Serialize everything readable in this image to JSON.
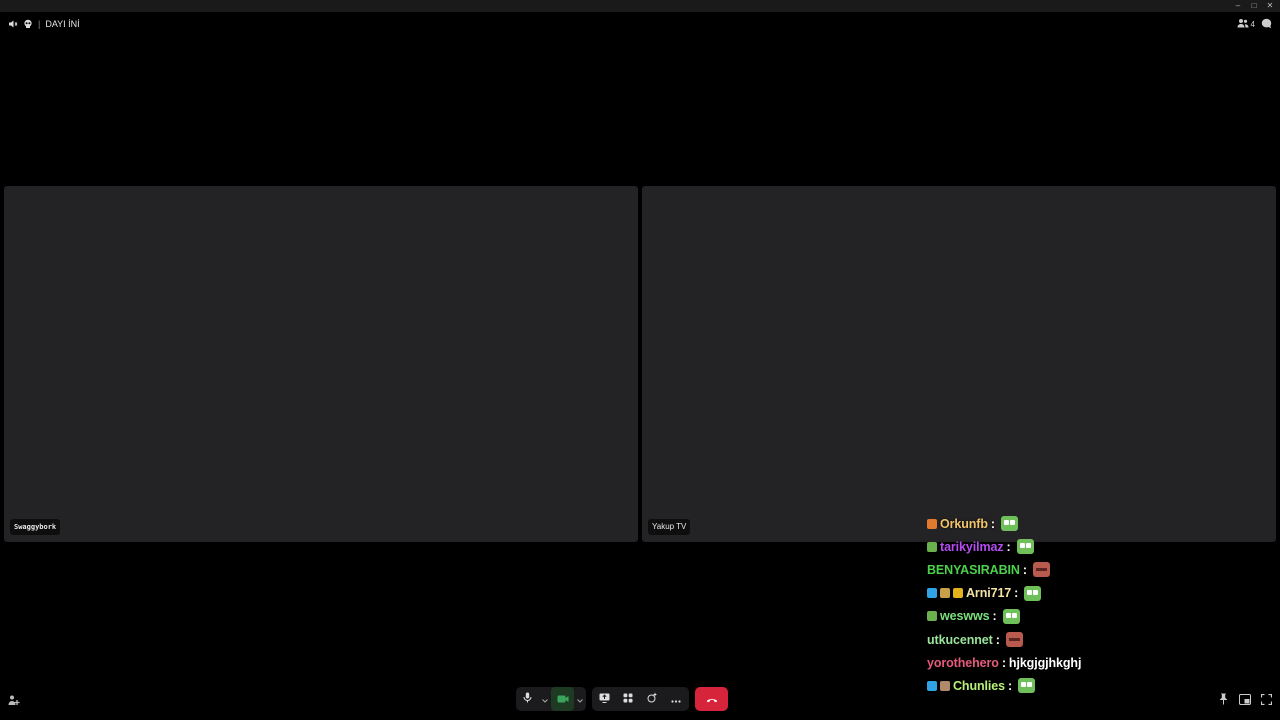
{
  "window": {
    "title": "DAYI İNİ"
  },
  "header": {
    "participant_count": "4"
  },
  "tiles": [
    {
      "name": "Swaggybork"
    },
    {
      "name": "Yakup TV"
    }
  ],
  "chat": [
    {
      "user": "Orkunfb",
      "color": "#f2c469",
      "badges": [
        "#e07a2e"
      ],
      "sep": ":",
      "emote": "green",
      "text": ""
    },
    {
      "user": "tarikyilmaz",
      "color": "#b44cf0",
      "badges": [
        "#6ab04c"
      ],
      "sep": ":",
      "emote": "green",
      "text": ""
    },
    {
      "user": "BENYASIRABIN",
      "color": "#4cd14c",
      "badges": [],
      "sep": ":",
      "emote": "red",
      "text": ""
    },
    {
      "user": "Arni717",
      "color": "#f3e3a8",
      "badges": [
        "#2fa3e6",
        "#c7a24a",
        "#e3b21c"
      ],
      "sep": ":",
      "emote": "green",
      "text": ""
    },
    {
      "user": "weswws",
      "color": "#7be07b",
      "badges": [
        "#6ab04c"
      ],
      "sep": ":",
      "emote": "green",
      "text": ""
    },
    {
      "user": "utkucennet",
      "color": "#9be49b",
      "badges": [],
      "sep": ":",
      "emote": "red",
      "text": ""
    },
    {
      "user": "yorothehero",
      "color": "#e65a7a",
      "badges": [],
      "sep": ":",
      "emote": "",
      "text": "hjkgjgjhkghj"
    },
    {
      "user": "Chunlies",
      "color": "#b8f07a",
      "badges": [
        "#2fa3e6",
        "#b08a6a"
      ],
      "sep": ":",
      "emote": "green",
      "text": ""
    }
  ],
  "icons": {
    "speaker": "speaker-muted-icon",
    "skull": "skull-icon",
    "people": "people-icon",
    "chat": "chat-bubble-icon",
    "mic": "microphone-icon",
    "camera": "camera-icon",
    "screenshare": "screen-share-icon",
    "activities": "activities-icon",
    "effects": "effects-icon",
    "more": "more-icon",
    "hangup": "hang-up-icon",
    "pin": "pin-icon",
    "popout": "pop-out-icon",
    "fullscreen": "fullscreen-icon"
  },
  "colors": {
    "tile_bg": "#232325",
    "hangup_red": "#d6243a",
    "camera_green": "#3ba55c"
  }
}
